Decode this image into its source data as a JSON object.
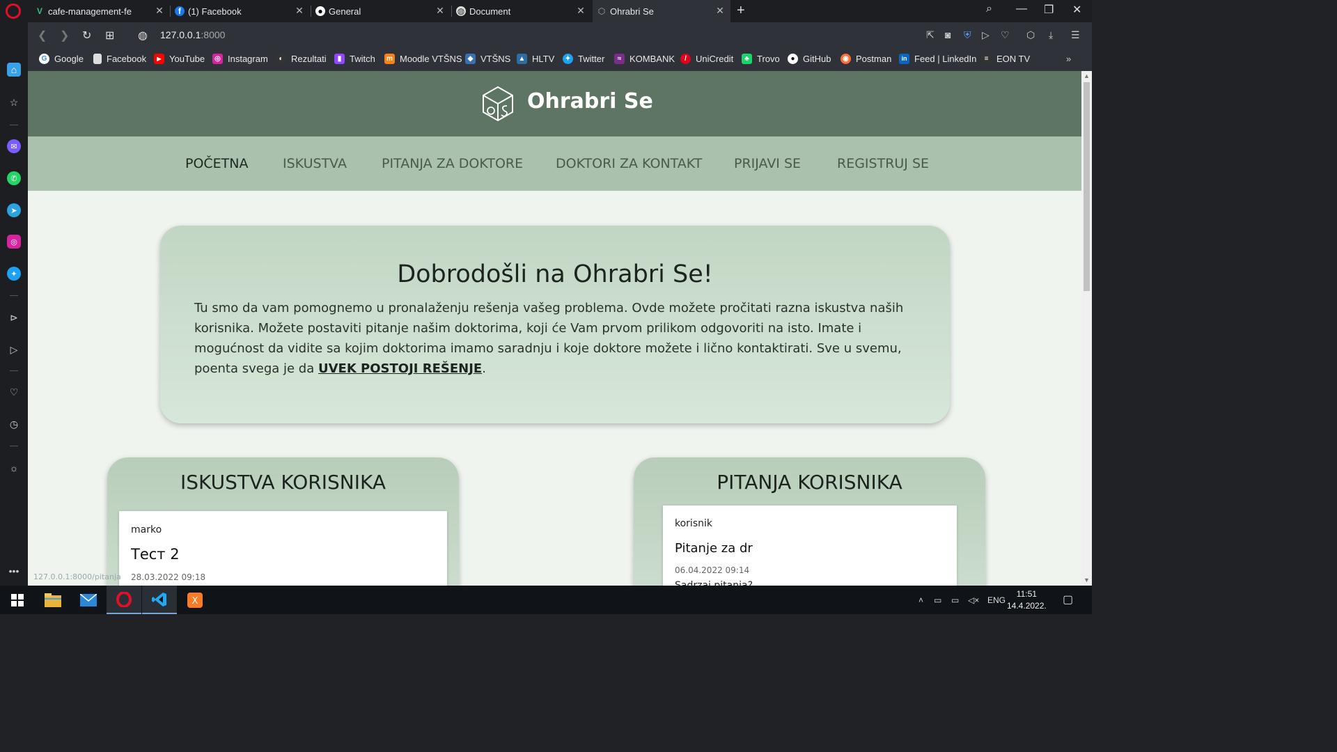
{
  "browser": {
    "tabs": [
      {
        "title": "cafe-management-fe",
        "icon": "vue-icon",
        "color": "#42b883"
      },
      {
        "title": "(1) Facebook",
        "icon": "facebook-icon",
        "color": "#1877f2"
      },
      {
        "title": "General",
        "icon": "github-icon",
        "color": "#ffffff"
      },
      {
        "title": "Document",
        "icon": "globe-icon",
        "color": "#dddddd"
      },
      {
        "title": "Ohrabri Se",
        "icon": "site-logo-icon",
        "color": "#aaaaaa",
        "active": true
      }
    ],
    "url_host": "127.0.0.1",
    "url_port": ":8000",
    "bookmarks": [
      {
        "label": "Google",
        "color": "#ffffff",
        "glyph": "G"
      },
      {
        "label": "Facebook",
        "color": "#dddddd",
        "glyph": ""
      },
      {
        "label": "YouTube",
        "color": "#ff0000",
        "glyph": "▶"
      },
      {
        "label": "Instagram",
        "color": "#d6249f",
        "glyph": "◎"
      },
      {
        "label": "Rezultati",
        "color": "#222222",
        "glyph": "⚽"
      },
      {
        "label": "Twitch",
        "color": "#9146ff",
        "glyph": "▮"
      },
      {
        "label": "Moodle VTŠNS",
        "color": "#f98012",
        "glyph": "m"
      },
      {
        "label": "VTŠNS",
        "color": "#3a6fb0",
        "glyph": "◆"
      },
      {
        "label": "HLTV",
        "color": "#2d6da3",
        "glyph": "▲"
      },
      {
        "label": "Twitter",
        "color": "#1da1f2",
        "glyph": "✦"
      },
      {
        "label": "KOMBANK",
        "color": "#7b2d8e",
        "glyph": "≈"
      },
      {
        "label": "UniCredit",
        "color": "#e2001a",
        "glyph": "/"
      },
      {
        "label": "Trovo",
        "color": "#19d66b",
        "glyph": "♣"
      },
      {
        "label": "GitHub",
        "color": "#ffffff",
        "glyph": "●"
      },
      {
        "label": "Postman",
        "color": "#ff6c37",
        "glyph": "◉"
      },
      {
        "label": "Feed | LinkedIn",
        "color": "#0a66c2",
        "glyph": "in"
      },
      {
        "label": "EON TV",
        "color": "#333333",
        "glyph": "≡"
      }
    ],
    "status_url": "127.0.0.1:8000/pitanja"
  },
  "site": {
    "title": "Ohrabri Se",
    "nav": [
      "POČETNA",
      "ISKUSTVA",
      "PITANJA ZA DOKTORE",
      "DOKTORI ZA KONTAKT",
      "PRIJAVI SE",
      "REGISTRUJ SE"
    ],
    "welcome": {
      "heading": "Dobrodošli na Ohrabri Se!",
      "text": "Tu smo da vam pomognemo u pronalaženju rešenja vašeg problema. Ovde možete pročitati razna iskustva naših korisnika. Možete postaviti pitanje našim doktorima, koji će Vam prvom prilikom odgovoriti na isto. Imate i mogućnost da vidite sa kojim doktorima imamo saradnju i koje doktore možete i lično kontaktirati. Sve u svemu, poenta svega je da ",
      "link": "UVEK POSTOJI REŠENJE",
      "suffix": "."
    },
    "experiences": {
      "heading": "ISKUSTVA KORISNIKA",
      "post": {
        "author": "marko",
        "title": "Тест 2",
        "date": "28.03.2022 09:18"
      }
    },
    "questions": {
      "heading": "PITANJA KORISNIKA",
      "post": {
        "author": "korisnik",
        "title": "Pitanje za dr",
        "date": "06.04.2022 09:14",
        "body": "Sadrzaj pitanja?"
      }
    },
    "colors": {
      "header": "#5d7562",
      "nav": "#a9c1ad",
      "page": "#f0f4ef"
    }
  },
  "taskbar": {
    "apps": [
      "windows-start-icon",
      "file-explorer-icon",
      "mail-icon",
      "opera-icon",
      "vscode-icon",
      "xampp-icon"
    ],
    "lang": "ENG",
    "time": "11:51",
    "date": "14.4.2022."
  }
}
